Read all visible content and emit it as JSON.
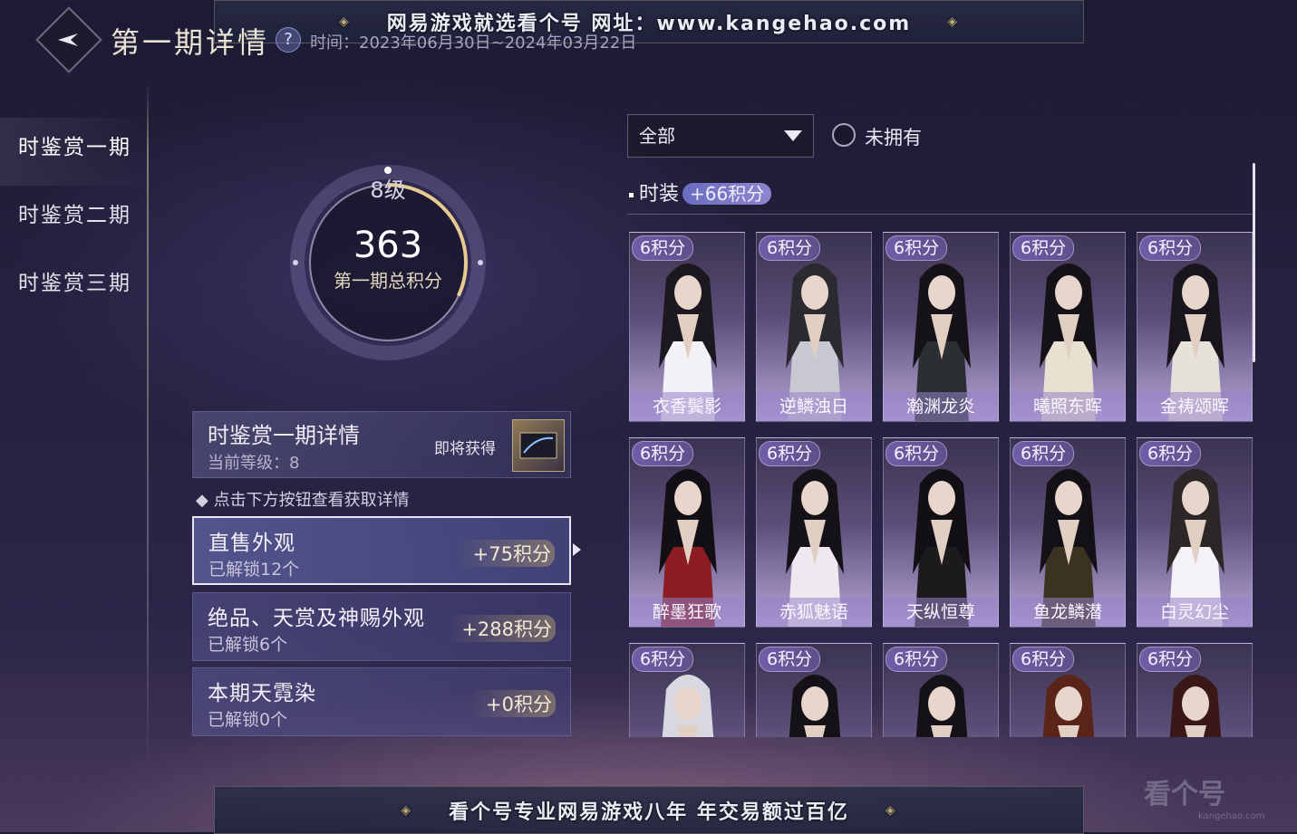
{
  "banner_top": "网易游戏就选看个号  网址：www.kangehao.com",
  "banner_bottom": "看个号专业网易游戏八年  年交易额过百亿",
  "header": {
    "title": "第一期详情",
    "help": "?",
    "date_range": "时间：2023年06月30日~2024年03月22日"
  },
  "sidebar": {
    "items": [
      {
        "label": "时鉴赏一期"
      },
      {
        "label": "时鉴赏二期"
      },
      {
        "label": "时鉴赏三期"
      }
    ]
  },
  "ring": {
    "level": "8级",
    "score": "363",
    "label": "第一期总积分",
    "progress": 0.32
  },
  "detail": {
    "title": "时鉴赏一期详情",
    "current_level": "当前等级：8",
    "coming": "即将获得"
  },
  "hint": "点击下方按钮查看获取详情",
  "categories": [
    {
      "title": "直售外观",
      "unlocked": "已解锁12个",
      "points": "+75积分"
    },
    {
      "title": "绝品、天赏及神赐外观",
      "unlocked": "已解锁6个",
      "points": "+288积分"
    },
    {
      "title": "本期天霓染",
      "unlocked": "已解锁0个",
      "points": "+0积分"
    }
  ],
  "filter": {
    "selected": "全部",
    "unowned_label": "未拥有"
  },
  "section": {
    "label": "时装",
    "points": "+66积分"
  },
  "items": [
    {
      "badge": "6积分",
      "name": "衣香鬓影",
      "hair": "#1b1820",
      "robe": "#f2f2f6"
    },
    {
      "badge": "6积分",
      "name": "逆鳞浊日",
      "hair": "#2a2a30",
      "robe": "#c8c8d2"
    },
    {
      "badge": "6积分",
      "name": "瀚渊龙炎",
      "hair": "#151218",
      "robe": "#2b2f34"
    },
    {
      "badge": "6积分",
      "name": "曦照东晖",
      "hair": "#141216",
      "robe": "#e8e0d0"
    },
    {
      "badge": "6积分",
      "name": "金祷颂晖",
      "hair": "#18161c",
      "robe": "#e6e2da"
    },
    {
      "badge": "6积分",
      "name": "醉墨狂歌",
      "hair": "#121014",
      "robe": "#8a1c22"
    },
    {
      "badge": "6积分",
      "name": "赤狐魅语",
      "hair": "#141216",
      "robe": "#efe8ef"
    },
    {
      "badge": "6积分",
      "name": "天纵恒尊",
      "hair": "#121014",
      "robe": "#1d1a1e"
    },
    {
      "badge": "6积分",
      "name": "鱼龙鳞潜",
      "hair": "#131116",
      "robe": "#3c3220"
    },
    {
      "badge": "6积分",
      "name": "白灵幻尘",
      "hair": "#2c2626",
      "robe": "#f4f2f6"
    },
    {
      "badge": "6积分",
      "name": "",
      "hair": "#d8d8e0",
      "robe": "#eeeef4"
    },
    {
      "badge": "6积分",
      "name": "",
      "hair": "#141216",
      "robe": "#6a7aa0"
    },
    {
      "badge": "6积分",
      "name": "",
      "hair": "#141216",
      "robe": "#cfd8e0"
    },
    {
      "badge": "6积分",
      "name": "",
      "hair": "#5a2418",
      "robe": "#a8321e"
    },
    {
      "badge": "6积分",
      "name": "",
      "hair": "#3a1818",
      "robe": "#b2262a"
    }
  ],
  "watermark": {
    "text": "看个号",
    "sub": "kangehao.com"
  }
}
